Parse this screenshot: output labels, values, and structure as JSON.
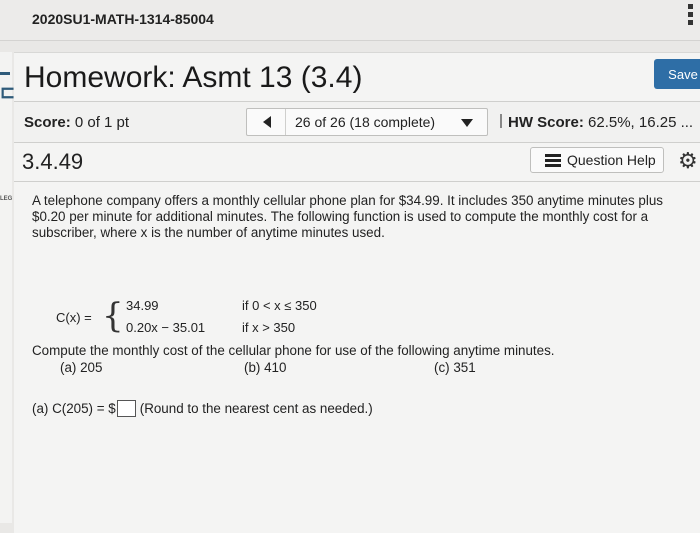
{
  "course_title": "2020SU1-MATH-1314-85004",
  "left_edge": {
    "label": "LEG"
  },
  "header": {
    "title": "Homework: Asmt 13 (3.4)",
    "save_label": "Save"
  },
  "score_bar": {
    "score_label": "Score:",
    "score_value": "0 of 1 pt",
    "progress": "26 of 26 (18 complete)",
    "hw_score_label": "HW Score:",
    "hw_score_value": "62.5%, 16.25 ..."
  },
  "question": {
    "number": "3.4.49",
    "help_label": "Question Help",
    "text": "A telephone company offers a monthly cellular phone plan for $34.99. It includes 350 anytime minutes plus $0.20 per minute for additional minutes. The following function is used to compute the monthly cost for a subscriber, where x is the number of anytime minutes used.",
    "function": {
      "name": "C(x) =",
      "pieces": [
        {
          "value": "34.99",
          "condition": "if 0 < x ≤ 350"
        },
        {
          "value": "0.20x − 35.01",
          "condition": "if x > 350"
        }
      ]
    },
    "prompt": "Compute the monthly cost of the cellular phone for use of the following anytime minutes.",
    "parts": [
      "(a) 205",
      "(b) 410",
      "(c) 351"
    ],
    "answer_prefix": "(a) C(205) = $",
    "answer_value": "",
    "answer_hint": "(Round to the nearest cent as needed.)"
  }
}
